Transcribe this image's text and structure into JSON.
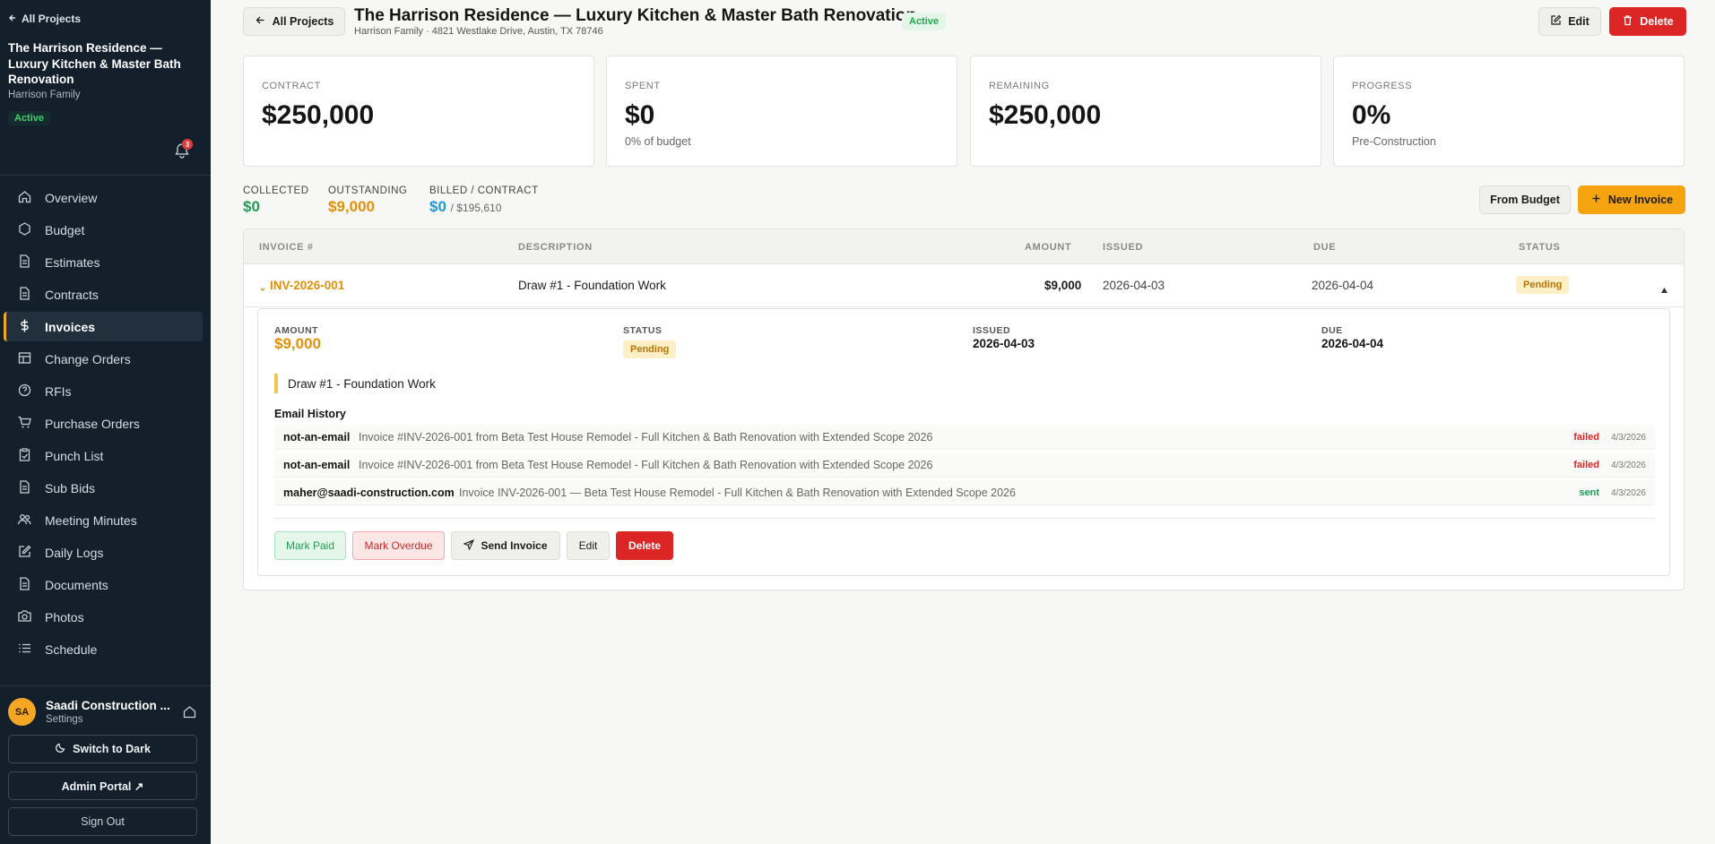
{
  "sidebar": {
    "back_label": "All Projects",
    "project_name": "The Harrison Residence — Luxury Kitchen & Master Bath Renovation",
    "client": "Harrison Family",
    "status": "Active",
    "notification_count": "3",
    "items": [
      {
        "label": "Overview",
        "icon": "home-icon"
      },
      {
        "label": "Budget",
        "icon": "hexagon-icon"
      },
      {
        "label": "Estimates",
        "icon": "document-icon"
      },
      {
        "label": "Contracts",
        "icon": "document-icon"
      },
      {
        "label": "Invoices",
        "icon": "dollar-icon"
      },
      {
        "label": "Change Orders",
        "icon": "table-icon"
      },
      {
        "label": "RFIs",
        "icon": "help-circle-icon"
      },
      {
        "label": "Purchase Orders",
        "icon": "cart-icon"
      },
      {
        "label": "Punch List",
        "icon": "clipboard-check-icon"
      },
      {
        "label": "Sub Bids",
        "icon": "document-icon"
      },
      {
        "label": "Meeting Minutes",
        "icon": "users-icon"
      },
      {
        "label": "Daily Logs",
        "icon": "edit-icon"
      },
      {
        "label": "Documents",
        "icon": "document-icon"
      },
      {
        "label": "Photos",
        "icon": "camera-icon"
      },
      {
        "label": "Schedule",
        "icon": "list-icon"
      }
    ],
    "active_item": "Invoices",
    "user": {
      "initials": "SA",
      "name": "Saadi Construction ...",
      "settings_label": "Settings"
    },
    "theme_button": "Switch to Dark",
    "admin_button": "Admin Portal ↗",
    "signout_button": "Sign Out"
  },
  "header": {
    "back_button": "All Projects",
    "title": "The Harrison Residence — Luxury Kitchen & Master Bath Renovation",
    "subtitle": "Harrison Family · 4821 Westlake Drive, Austin, TX 78746",
    "status": "Active",
    "edit_button": "Edit",
    "delete_button": "Delete"
  },
  "cards": [
    {
      "label": "CONTRACT",
      "value": "$250,000",
      "sub": ""
    },
    {
      "label": "SPENT",
      "value": "$0",
      "sub": "0% of budget"
    },
    {
      "label": "REMAINING",
      "value": "$250,000",
      "sub": ""
    },
    {
      "label": "PROGRESS",
      "value": "0%",
      "sub": "Pre-Construction"
    }
  ],
  "stats": {
    "collected_label": "COLLECTED",
    "collected_value": "$0",
    "outstanding_label": "OUTSTANDING",
    "outstanding_value": "$9,000",
    "billed_label": "BILLED / CONTRACT",
    "billed_value": "$0",
    "billed_tail": "/ $195,610"
  },
  "actions": {
    "from_budget": "From Budget",
    "new_invoice": "New Invoice"
  },
  "table": {
    "headers": {
      "invoice": "INVOICE #",
      "description": "DESCRIPTION",
      "amount": "AMOUNT",
      "issued": "ISSUED",
      "due": "DUE",
      "status": "STATUS"
    },
    "rows": [
      {
        "invoice": "INV-2026-001",
        "description": "Draw #1 - Foundation Work",
        "amount": "$9,000",
        "issued": "2026-04-03",
        "due": "2026-04-04",
        "status": "Pending"
      }
    ]
  },
  "detail": {
    "amount_label": "AMOUNT",
    "amount_value": "$9,000",
    "status_label": "STATUS",
    "status_value": "Pending",
    "issued_label": "ISSUED",
    "issued_value": "2026-04-03",
    "due_label": "DUE",
    "due_value": "2026-04-04",
    "description": "Draw #1 - Foundation Work",
    "email_history_title": "Email History",
    "emails": [
      {
        "to": "not-an-email",
        "subject": "Invoice #INV-2026-001 from Beta Test House Remodel - Full Kitchen & Bath Renovation with Extended Scope 2026",
        "status": "failed",
        "date": "4/3/2026"
      },
      {
        "to": "not-an-email",
        "subject": "Invoice #INV-2026-001 from Beta Test House Remodel - Full Kitchen & Bath Renovation with Extended Scope 2026",
        "status": "failed",
        "date": "4/3/2026"
      },
      {
        "to": "maher@saadi-construction.com",
        "subject": "Invoice INV-2026-001 — Beta Test House Remodel - Full Kitchen & Bath Renovation with Extended Scope 2026",
        "status": "sent",
        "date": "4/3/2026"
      }
    ],
    "buttons": {
      "mark_paid": "Mark Paid",
      "mark_overdue": "Mark Overdue",
      "send_invoice": "Send Invoice",
      "edit": "Edit",
      "delete": "Delete"
    }
  },
  "colors": {
    "accent": "#f5a30f",
    "sidebar_bg": "#13202c",
    "danger": "#dc2626",
    "success": "#1f9d55",
    "info": "#1a9bd7"
  }
}
